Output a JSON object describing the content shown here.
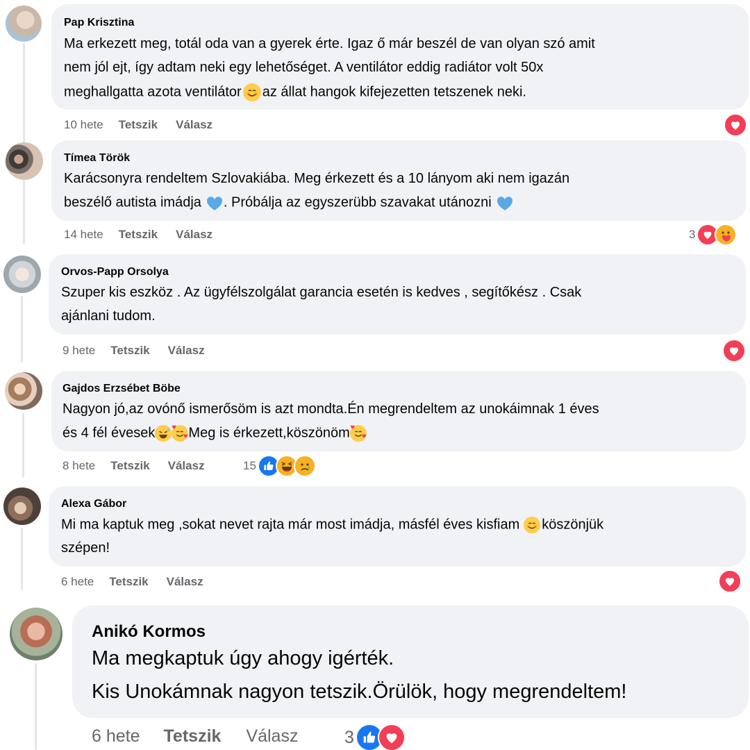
{
  "comments": [
    {
      "author": "Pap Krisztina",
      "lines": [
        "Ma erkezett meg, totál oda van a gyerek érte. Igaz ő már beszél de van olyan szó amit",
        "nem jól ejt, így adtam neki egy lehetőséget. A ventilátor eddig radiátor volt 50x",
        "meghallgatta azota ventilátor",
        "az állat hangok kifejezetten tetszenek neki."
      ],
      "time": "10 hete",
      "like": "Tetszik",
      "reply": "Válasz",
      "reactions": [
        "love"
      ],
      "count": ""
    },
    {
      "author": "Tímea Török",
      "lines": [
        "Karácsonyra rendeltem Szlovakiába. Meg érkezett és a 10 lányom aki nem igazán",
        "beszélő autista imádja",
        ". Próbálja az egyszerübb szavakat utánozni"
      ],
      "time": "14 hete",
      "like": "Tetszik",
      "reply": "Válasz",
      "reactions": [
        "love",
        "care"
      ],
      "count": "3"
    },
    {
      "author": "Orvos-Papp Orsolya",
      "lines": [
        "Szuper kis eszköz . Az ügyfélszolgálat garancia esetén is kedves , segítőkész . Csak",
        "ajánlani tudom."
      ],
      "time": "9 hete",
      "like": "Tetszik",
      "reply": "Válasz",
      "reactions": [
        "love"
      ],
      "count": ""
    },
    {
      "author": "Gajdos Erzsébet Böbe",
      "lines": [
        "Nagyon jó,az ovónő ismerősöm is azt mondta.Én megrendeltem az unokáimnak 1 éves",
        "és 4 fél évesek",
        "Meg is érkezett,köszönöm"
      ],
      "time": "8 hete",
      "like": "Tetszik",
      "reply": "Válasz",
      "reactions": [
        "like",
        "haha",
        "sad"
      ],
      "count": "15"
    },
    {
      "author": "Alexa Gábor",
      "lines": [
        "Mi ma kaptuk meg ,sokat nevet rajta már most imádja, másfél éves kisfiam",
        "köszönjük",
        "szépen!"
      ],
      "time": "6 hete",
      "like": "Tetszik",
      "reply": "Válasz",
      "reactions": [
        "love"
      ],
      "count": ""
    },
    {
      "author": "Anikó Kormos",
      "lines": [
        "Ma megkaptuk úgy ahogy igérték.",
        "Kis Unokámnak nagyon tetszik.Örülök, hogy megrendeltem!"
      ],
      "time": "6 hete",
      "like": "Tetszik",
      "reply": "Válasz",
      "reactions": [
        "like",
        "love"
      ],
      "count": "3"
    }
  ],
  "colors": {
    "bubble": "#f0f2f5",
    "meta": "#65676b",
    "love": "#f33e58",
    "like": "#1877f2",
    "heart_blue": "#5aa9e6"
  },
  "icons": {
    "love": "heart-icon",
    "care": "care-emoji-icon",
    "like": "thumbs-up-icon",
    "haha": "haha-emoji-icon",
    "sad": "sad-emoji-icon",
    "smile": "smiling-face-icon",
    "blue_heart": "blue-heart-icon",
    "hearts_face": "smiling-face-with-hearts-icon"
  }
}
